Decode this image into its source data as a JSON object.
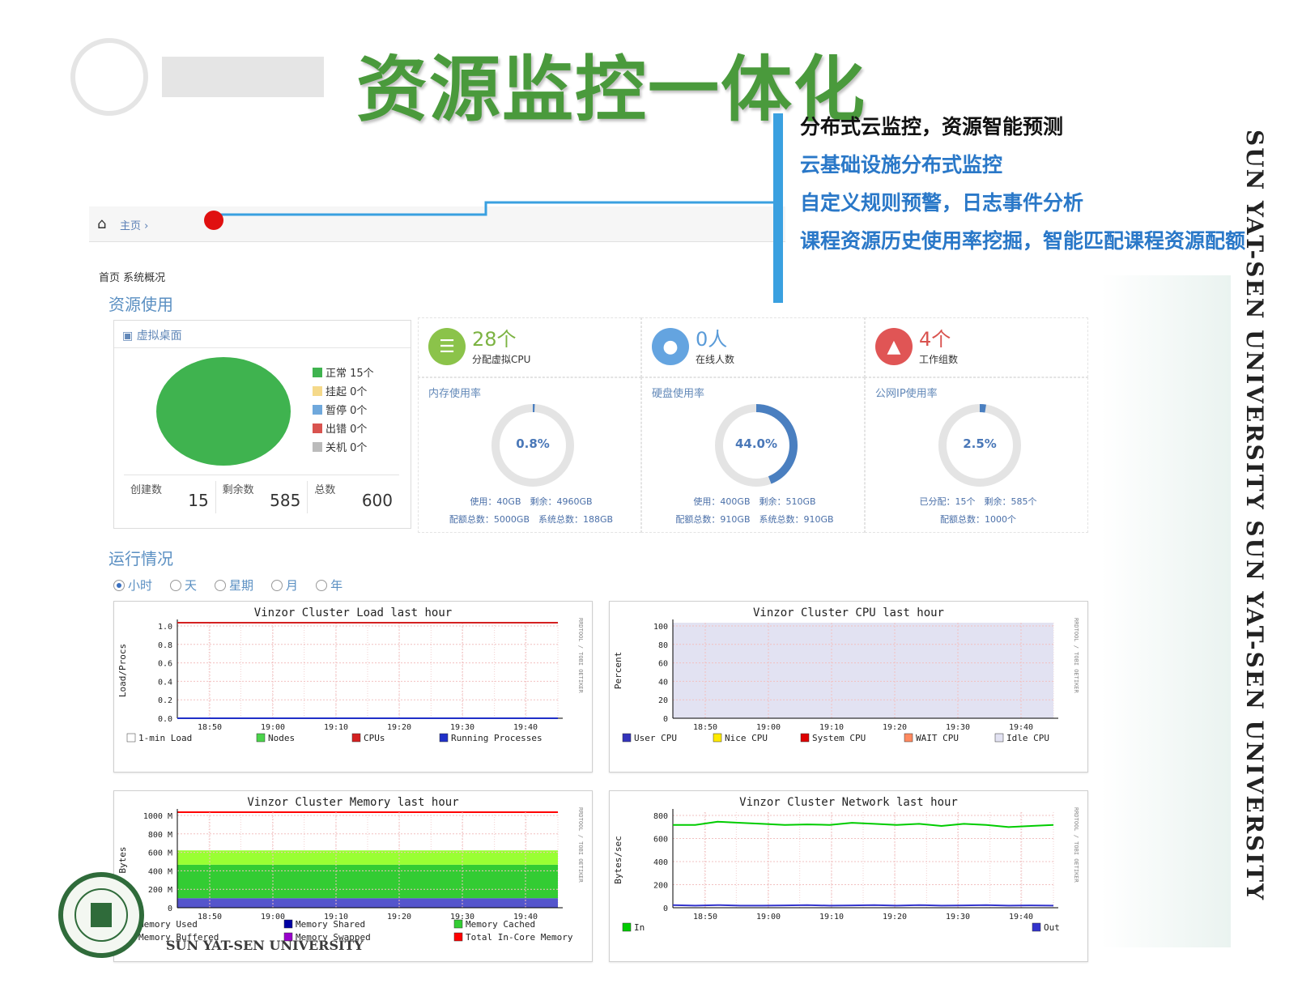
{
  "slide": {
    "title": "资源监控一体化",
    "bullets": [
      "分布式云监控，资源智能预测",
      "云基础设施分布式监控",
      "自定义规则预警，日志事件分析",
      "课程资源历史使用率挖掘，智能匹配课程资源配额"
    ],
    "vertical_text": "SUN YAT-SEN UNIVERSITY   SUN YAT-SEN UNIVERSITY",
    "footer_logo_text": "SUN YAT-SEN UNIVERSITY"
  },
  "nav": {
    "home_label": "主页",
    "separator": "›",
    "sub_crumb": "首页 系统概况"
  },
  "resource": {
    "section_title": "资源使用",
    "vdesk": {
      "title": "虚拟桌面",
      "legend": [
        {
          "label": "正常 15个",
          "color": "#3fb34f"
        },
        {
          "label": "挂起 0个",
          "color": "#f5d98a"
        },
        {
          "label": "暂停 0个",
          "color": "#6fa8dc"
        },
        {
          "label": "出错 0个",
          "color": "#d9534f"
        },
        {
          "label": "关机 0个",
          "color": "#bbbbbb"
        }
      ],
      "stats": [
        {
          "label": "创建数",
          "value": "15"
        },
        {
          "label": "剩余数",
          "value": "585"
        },
        {
          "label": "总数",
          "value": "600"
        }
      ]
    },
    "kpis": [
      {
        "num": "28个",
        "label": "分配虚拟CPU",
        "icon": "server-icon",
        "color": "#8bc34a",
        "num_color": "#7cb342"
      },
      {
        "num": "0人",
        "label": "在线人数",
        "icon": "users-icon",
        "color": "#64a4e0",
        "num_color": "#5a9bd8"
      },
      {
        "num": "4个",
        "label": "工作组数",
        "icon": "flask-icon",
        "color": "#e05555",
        "num_color": "#d9534f"
      }
    ],
    "gauges": [
      {
        "title": "内存使用率",
        "value": "0.8%",
        "fraction": 0.008,
        "line1": "使用：40GB　剩余：4960GB",
        "line2": "配额总数：5000GB　系统总数：188GB"
      },
      {
        "title": "硬盘使用率",
        "value": "44.0%",
        "fraction": 0.44,
        "line1": "使用：400GB　剩余：510GB",
        "line2": "配额总数：910GB　系统总数：910GB"
      },
      {
        "title": "公网IP使用率",
        "value": "2.5%",
        "fraction": 0.025,
        "line1": "已分配：15个　剩余：585个",
        "line2": "配额总数：1000个"
      }
    ]
  },
  "running": {
    "section_title": "运行情况",
    "ranges": [
      {
        "label": "小时",
        "selected": true
      },
      {
        "label": "天",
        "selected": false
      },
      {
        "label": "星期",
        "selected": false
      },
      {
        "label": "月",
        "selected": false
      },
      {
        "label": "年",
        "selected": false
      }
    ]
  },
  "chart_data": [
    {
      "type": "line",
      "title": "Vinzor Cluster Load last hour",
      "ylabel": "Load/Procs",
      "side_label": "RRDTOOL / TOBI OETIKER",
      "x_ticks": [
        "18:50",
        "19:00",
        "19:10",
        "19:20",
        "19:30",
        "19:40"
      ],
      "y_ticks": [
        "1.0",
        "0.8",
        "0.6",
        "0.4",
        "0.2",
        "0.0"
      ],
      "ylim": [
        0,
        1
      ],
      "x": [
        0,
        1
      ],
      "series": [
        {
          "name": "1-min Load",
          "color": "#ffffff",
          "values": [
            0,
            0
          ]
        },
        {
          "name": "Nodes",
          "color": "#4bd44b",
          "values": [
            1,
            1
          ]
        },
        {
          "name": "CPUs",
          "color": "#d42020",
          "values": [
            1,
            1
          ]
        },
        {
          "name": "Running Processes",
          "color": "#2030c8",
          "values": [
            0,
            0
          ]
        }
      ]
    },
    {
      "type": "area",
      "title": "Vinzor Cluster CPU last hour",
      "ylabel": "Percent",
      "side_label": "RRDTOOL / TOBI OETIKER",
      "x_ticks": [
        "18:50",
        "19:00",
        "19:10",
        "19:20",
        "19:30",
        "19:40"
      ],
      "y_ticks": [
        "100",
        "80",
        "60",
        "40",
        "20",
        "0"
      ],
      "ylim": [
        0,
        100
      ],
      "series": [
        {
          "name": "User CPU",
          "color": "#3333bb",
          "values": [
            0,
            0
          ]
        },
        {
          "name": "Nice CPU",
          "color": "#ffea00",
          "values": [
            0,
            0
          ]
        },
        {
          "name": "System CPU",
          "color": "#dd0000",
          "values": [
            0,
            0
          ]
        },
        {
          "name": "WAIT CPU",
          "color": "#ff8a60",
          "values": [
            0,
            0
          ]
        },
        {
          "name": "Idle CPU",
          "color": "#e2e2f2",
          "values": [
            100,
            100
          ]
        }
      ]
    },
    {
      "type": "area",
      "title": "Vinzor Cluster Memory last hour",
      "ylabel": "Bytes",
      "side_label": "RRDTOOL / TOBI OETIKER",
      "x_ticks": [
        "18:50",
        "19:00",
        "19:10",
        "19:20",
        "19:30",
        "19:40"
      ],
      "y_ticks": [
        "1000 M",
        "800 M",
        "600 M",
        "400 M",
        "200 M",
        "0"
      ],
      "ylim": [
        0,
        1000
      ],
      "series": [
        {
          "name": "Memory Used",
          "color": "#5555cc",
          "values": [
            100,
            100
          ]
        },
        {
          "name": "Memory Shared",
          "color": "#0000a3",
          "values": [
            0,
            0
          ]
        },
        {
          "name": "Memory Cached",
          "color": "#33cc33",
          "values": [
            350,
            350
          ]
        },
        {
          "name": "Memory Buffered",
          "color": "#99ff33",
          "values": [
            150,
            150
          ]
        },
        {
          "name": "Memory Swapped",
          "color": "#9900cc",
          "values": [
            0,
            0
          ]
        },
        {
          "name": "Total In-Core Memory",
          "color": "#ff0000",
          "values": [
            1000,
            1000
          ]
        }
      ]
    },
    {
      "type": "line",
      "title": "Vinzor Cluster Network last hour",
      "ylabel": "Bytes/sec",
      "side_label": "RRDTOOL / TOBI OETIKER",
      "x_ticks": [
        "18:50",
        "19:00",
        "19:10",
        "19:20",
        "19:30",
        "19:40"
      ],
      "y_ticks": [
        "800",
        "600",
        "400",
        "200",
        "0"
      ],
      "ylim": [
        0,
        900
      ],
      "series": [
        {
          "name": "In",
          "color": "#00cc00",
          "values": [
            780,
            780,
            810,
            800,
            790,
            780,
            785,
            780,
            800,
            790,
            780,
            790,
            770,
            790,
            780,
            760,
            770,
            780
          ]
        },
        {
          "name": "Out",
          "color": "#3333cc",
          "values": [
            25,
            20,
            25,
            20,
            20,
            22,
            25,
            20,
            22,
            25,
            20,
            25,
            20,
            22,
            25,
            20,
            22,
            20
          ]
        }
      ]
    }
  ]
}
